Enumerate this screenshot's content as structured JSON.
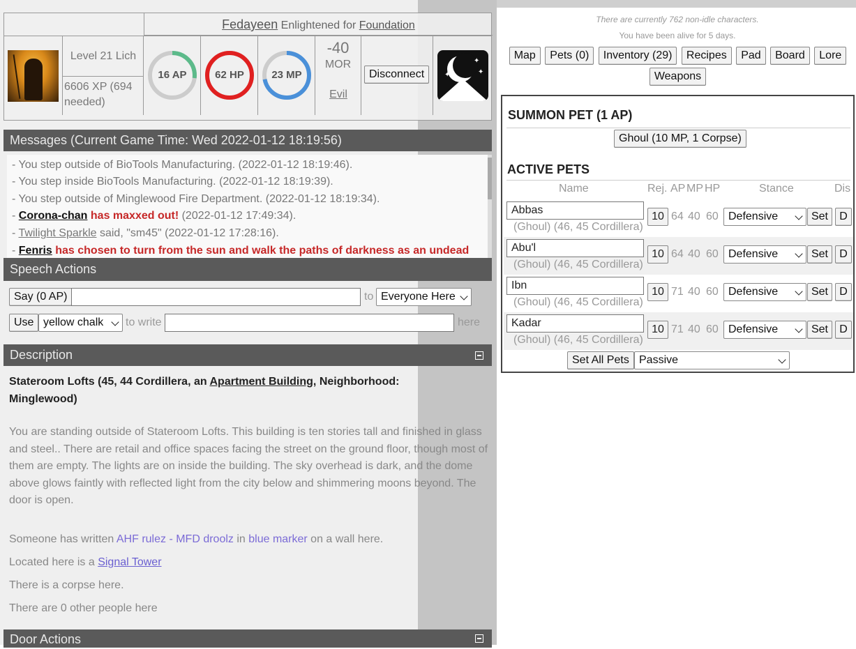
{
  "header": {
    "char_name": "Fedayeen",
    "title_mid": "Enlightened for",
    "faction": "Foundation",
    "level": "Level 21 Lich",
    "xp": "6606 XP (694 needed)",
    "gauges": [
      {
        "label": "16 AP",
        "fraction": 0.27,
        "color": "#5cba8a"
      },
      {
        "label": "62 HP",
        "fraction": 1.0,
        "color": "#e02020"
      },
      {
        "label": "23 MP",
        "fraction": 0.72,
        "color": "#4a90d9"
      }
    ],
    "morality_value": "-40",
    "morality_label": "MOR",
    "alignment": "Evil",
    "disconnect_label": "Disconnect"
  },
  "messages": {
    "heading": "Messages (Current Game Time: Wed 2022-01-12 18:19:56)",
    "items": [
      {
        "text": "- You step outside of BioTools Manufacturing. (2022-01-12 18:19:46)."
      },
      {
        "text": "- You step inside BioTools Manufacturing. (2022-01-12 18:19:39)."
      },
      {
        "text": "- You step outside of Minglewood Fire Department. (2022-01-12 18:19:34)."
      },
      {
        "prefix": "- ",
        "name": "Corona-chan",
        "highlight": " has maxxed out!",
        "rest": " (2022-01-12 17:49:34)."
      },
      {
        "prefix": "- ",
        "user": "Twilight Sparkle",
        "rest": " said, \"sm45\" (2022-01-12 17:28:16)."
      },
      {
        "prefix": "- ",
        "name": "Fenris",
        "highlight": " has chosen to turn from the sun and walk the paths of darkness as an undead"
      }
    ]
  },
  "speech": {
    "heading": "Speech Actions",
    "say_label": "Say (0 AP)",
    "say_value": "",
    "to_label": "to",
    "target": "Everyone Here",
    "use_label": "Use",
    "tool": "yellow chalk",
    "to_write_label": "to write",
    "write_value": "",
    "here_label": "here"
  },
  "description": {
    "heading": "Description",
    "title_pre": "Stateroom Lofts (45, 44 Cordillera, an ",
    "building_type": "Apartment Building",
    "title_post": ", Neighborhood: Minglewood)",
    "text": "You are standing outside of Stateroom Lofts. This building is ten stories tall and finished in glass and steel.. There are retail and office spaces facing the street on the ground floor, though most of them are empty. The lights are on inside the building. The sky overhead is dark, and the dome above glows faintly with reflected light from the city below and shimmering moons beyond. The door is open.",
    "graffiti_pre": "Someone has written ",
    "graffiti_text": "AHF rulez - MFD droolz",
    "graffiti_mid": " in ",
    "graffiti_tool": "blue marker",
    "graffiti_post": " on a wall here.",
    "located_pre": "Located here is a ",
    "located_link": "Signal Tower",
    "corpse": "There is a corpse here.",
    "people": "There are 0 other people here"
  },
  "door": {
    "heading": "Door Actions"
  },
  "status": {
    "characters": "There are currently 762 non-idle characters.",
    "alive": "You have been alive for 5 days."
  },
  "nav": {
    "map": "Map",
    "pets": "Pets (0)",
    "inventory": "Inventory (29)",
    "recipes": "Recipes",
    "pad": "Pad",
    "board": "Board",
    "lore": "Lore",
    "weapons": "Weapons"
  },
  "pets": {
    "summon_heading": "SUMMON PET (1 AP)",
    "summon_button": "Ghoul (10 MP, 1 Corpse)",
    "active_heading": "ACTIVE PETS",
    "headers": {
      "name": "Name",
      "rej": "Rej.",
      "ap": "AP",
      "mp": "MP",
      "hp": "HP",
      "stance": "Stance",
      "dis": "Dis"
    },
    "rows": [
      {
        "name": "Abbas",
        "sub": "(Ghoul) (46, 45 Cordillera)",
        "rej": "10",
        "ap": "64",
        "mp": "40",
        "hp": "60",
        "stance": "Defensive",
        "set": "Set",
        "d": "D"
      },
      {
        "name": "Abu'l",
        "sub": "(Ghoul) (46, 45 Cordillera)",
        "rej": "10",
        "ap": "64",
        "mp": "40",
        "hp": "60",
        "stance": "Defensive",
        "set": "Set",
        "d": "D"
      },
      {
        "name": "Ibn",
        "sub": "(Ghoul) (46, 45 Cordillera)",
        "rej": "10",
        "ap": "71",
        "mp": "40",
        "hp": "60",
        "stance": "Defensive",
        "set": "Set",
        "d": "D"
      },
      {
        "name": "Kadar",
        "sub": "(Ghoul) (46, 45 Cordillera)",
        "rej": "10",
        "ap": "71",
        "mp": "40",
        "hp": "60",
        "stance": "Defensive",
        "set": "Set",
        "d": "D"
      }
    ],
    "set_all_label": "Set All Pets",
    "set_all_value": "Passive"
  }
}
